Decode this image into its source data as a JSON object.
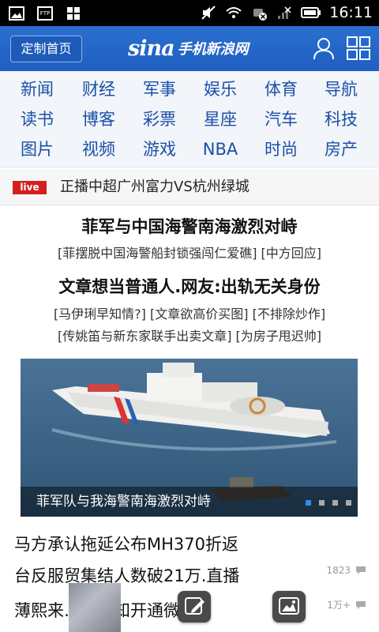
{
  "status_bar": {
    "time": "16:11",
    "left_icons": [
      "image-icon",
      "ftp-icon",
      "apps-icon"
    ],
    "right_icons": [
      "mute-icon",
      "wifi-icon",
      "signal-off-icon",
      "battery-icon"
    ]
  },
  "header": {
    "custom_home_label": "定制首页",
    "logo_brand": "sina",
    "logo_text": "手机新浪网",
    "user_icon": "user-icon",
    "menu_icon": "grid-menu-icon",
    "accent_color": "#2a6fd0"
  },
  "nav": {
    "rows": [
      [
        "新闻",
        "财经",
        "军事",
        "娱乐",
        "体育",
        "导航"
      ],
      [
        "读书",
        "博客",
        "彩票",
        "星座",
        "汽车",
        "科技"
      ],
      [
        "图片",
        "视频",
        "游戏",
        "NBA",
        "时尚",
        "房产"
      ]
    ]
  },
  "live": {
    "badge": "live",
    "text": "正播中超广州富力VS杭州绿城"
  },
  "headlines": [
    {
      "title": "菲军与中国海警南海激烈对峙",
      "subs": [
        "[菲摆脱中国海警船封锁强闯仁爱礁] [中方回应]"
      ]
    },
    {
      "title": "文章想当普通人.网友:出轨无关身份",
      "subs": [
        "[马伊琍早知情?] [文章欲高价买图] [不排除炒作]",
        "[传姚笛与新东家联手出卖文章] [为房子甩迟帅]"
      ]
    }
  ],
  "photo": {
    "caption": "菲军队与我海警南海激烈对峙",
    "dot_count": 4,
    "active_dot": 0
  },
  "list": [
    {
      "title": "马方承认拖延公布MH370折返",
      "count": ""
    },
    {
      "title": "台反服贸集结人数破21万.直播",
      "count": "1823"
    },
    {
      "title": "薄熙来……望知开通微博",
      "count": "1万+"
    }
  ]
}
